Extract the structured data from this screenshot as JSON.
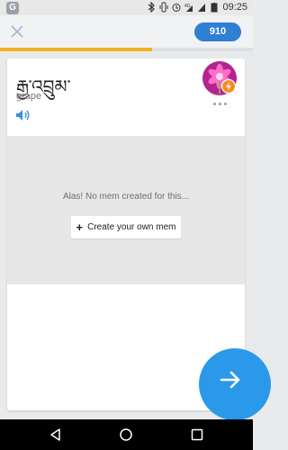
{
  "status_bar": {
    "left_icon": "G",
    "icons": [
      "bluetooth-icon",
      "vibrate-icon",
      "alarm-icon",
      "signal-4g-icon",
      "signal-icon",
      "battery-icon"
    ],
    "time": "09:25"
  },
  "top_bar": {
    "score": "910",
    "progress_fraction": 0.6
  },
  "card": {
    "word": "རྒྱ་འབྲུམ་",
    "meaning": "grape",
    "mem_message": "Alas! No mem created for this...",
    "create_button_label": "Create your own mem"
  },
  "colors": {
    "accent_blue": "#2a99ea",
    "score_blue": "#2f7fd4",
    "progress_yellow": "#f2b11e",
    "avatar_magenta": "#c0289a",
    "badge_orange": "#f58a1f"
  }
}
